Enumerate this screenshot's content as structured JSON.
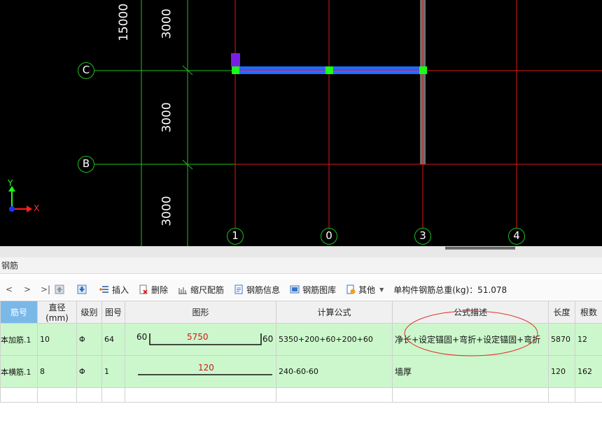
{
  "cad": {
    "dimensions": {
      "left_total": "15000",
      "seg_top": "3000",
      "seg_mid": "3000",
      "seg_bottom": "3000"
    },
    "row_axes": [
      "C",
      "B"
    ],
    "col_axes": [
      "1",
      "0",
      "3",
      "4"
    ],
    "ucs": {
      "y_label": "Y",
      "x_label": "X"
    }
  },
  "panel": {
    "title": "钢筋"
  },
  "toolbar": {
    "nav_prev": "<",
    "nav_next": ">",
    "nav_last": ">|",
    "insert": "插入",
    "delete": "删除",
    "scale_rebar": "缩尺配筋",
    "rebar_info": "钢筋信息",
    "rebar_library": "钢筋图库",
    "other": "其他",
    "total_weight": "单构件钢筋总重(kg)：51.078"
  },
  "table": {
    "columns": [
      "筋号",
      "直径(mm)",
      "级别",
      "图号",
      "图形",
      "计算公式",
      "公式描述",
      "长度",
      "根数"
    ],
    "rows": [
      {
        "name": "本加筋.1",
        "diameter": "10",
        "grade": "Φ",
        "fig_no": "64",
        "shape_left": "60",
        "shape_mid": "5750",
        "shape_right": "60",
        "formula": "5350+200+60+200+60",
        "desc": "净长+设定锚固+弯折+设定锚固+弯折",
        "length": "5870",
        "count": "12"
      },
      {
        "name": "本横筋.1",
        "diameter": "8",
        "grade": "Φ",
        "fig_no": "1",
        "shape_mid": "120",
        "formula": "240-60-60",
        "desc": "墙厚",
        "length": "120",
        "count": "162"
      }
    ]
  },
  "colors": {
    "grid_red": "#e01818",
    "grid_green": "#1fbf1f",
    "beam_blue": "#1e6bff",
    "node_green": "#19ff19",
    "row_green": "#ccf7cc",
    "header_blue": "#7ab8e8"
  }
}
